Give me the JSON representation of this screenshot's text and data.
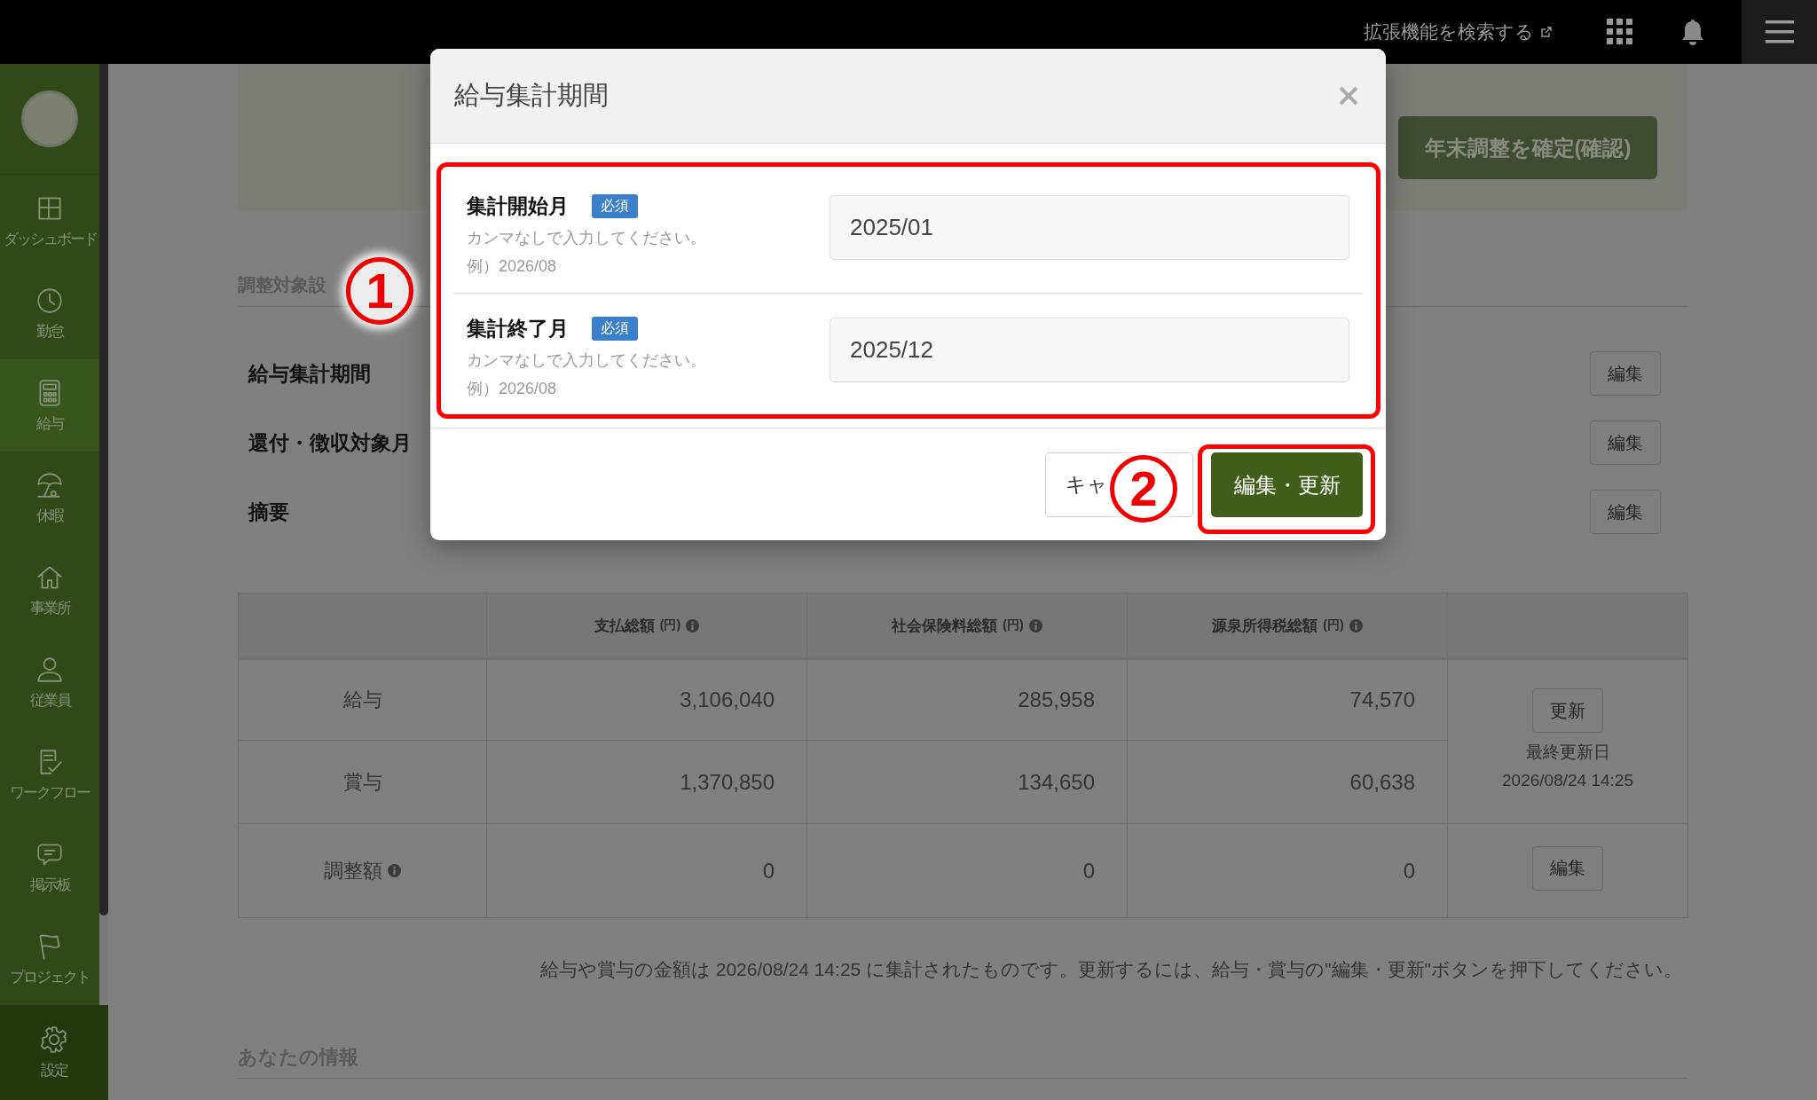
{
  "top_bar": {
    "extension_search": "拡張機能を検索する"
  },
  "sidebar": {
    "items": [
      {
        "label": "ダッシュボード",
        "selected": false
      },
      {
        "label": "勤怠",
        "selected": false
      },
      {
        "label": "給与",
        "selected": true
      },
      {
        "label": "休暇",
        "selected": false
      },
      {
        "label": "事業所",
        "selected": false
      },
      {
        "label": "従業員",
        "selected": false
      },
      {
        "label": "ワークフロー",
        "selected": false
      },
      {
        "label": "掲示板",
        "selected": false
      },
      {
        "label": "プロジェクト",
        "selected": false
      },
      {
        "label": "設定",
        "selected": false
      }
    ]
  },
  "page": {
    "confirm_button": "年末調整を確定(確認)",
    "section_title": "調整対象設",
    "settings": [
      {
        "label": "給与集計期間",
        "button": "編集"
      },
      {
        "label": "還付・徴収対象月",
        "button": "編集"
      },
      {
        "label": "摘要",
        "button": "編集"
      }
    ],
    "table": {
      "columns": [
        {
          "label": "支払総額",
          "unit": "(円)"
        },
        {
          "label": "社会保険料総額",
          "unit": "(円)"
        },
        {
          "label": "源泉所得税総額",
          "unit": "(円)"
        }
      ],
      "rows": [
        {
          "label": "給与",
          "info": false,
          "values": [
            "3,106,040",
            "285,958",
            "74,570"
          ]
        },
        {
          "label": "賞与",
          "info": false,
          "values": [
            "1,370,850",
            "134,650",
            "60,638"
          ]
        },
        {
          "label": "調整額",
          "info": true,
          "values": [
            "0",
            "0",
            "0"
          ]
        }
      ],
      "update_button": "更新",
      "updated_caption": "最終更新日",
      "updated_at": "2026/08/24 14:25",
      "adjust_button": "編集"
    },
    "note": "給与や賞与の金額は 2026/08/24 14:25 に集計されたものです。更新するには、給与・賞与の\"編集・更新\"ボタンを押下してください。",
    "info_title": "あなたの情報"
  },
  "modal": {
    "title": "給与集計期間",
    "fields": [
      {
        "label": "集計開始月",
        "badge": "必須",
        "help": "カンマなしで入力してください。",
        "example": "例）2026/08",
        "value": "2025/01"
      },
      {
        "label": "集計終了月",
        "badge": "必須",
        "help": "カンマなしで入力してください。",
        "example": "例）2026/08",
        "value": "2025/12"
      }
    ],
    "cancel_button": "キャ",
    "submit_button": "編集・更新"
  },
  "annotations": [
    "1",
    "2"
  ]
}
